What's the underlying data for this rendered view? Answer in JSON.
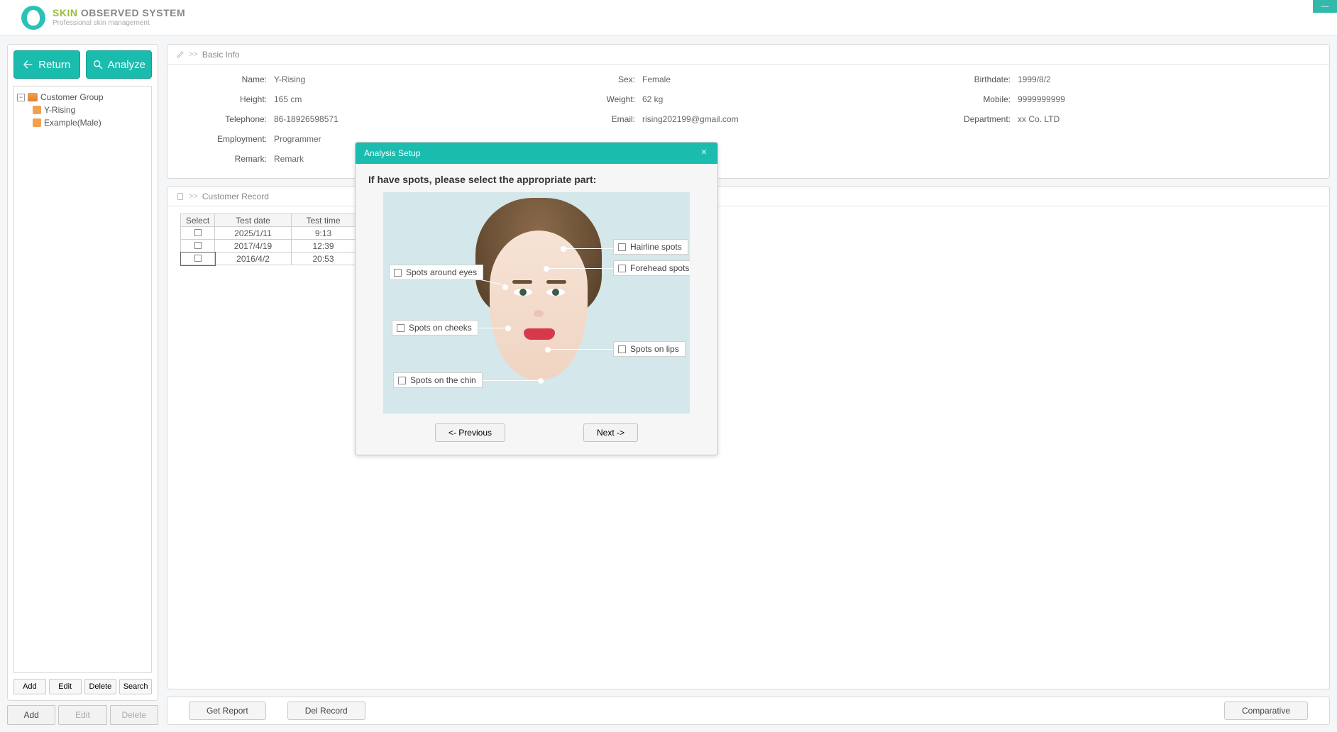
{
  "brand": {
    "skin": "SKIN",
    "obs": "OBSERVED SYSTEM",
    "sub": "Professional skin management"
  },
  "sidebar": {
    "return_label": "Return",
    "analyze_label": "Analyze",
    "tree": {
      "root": "Customer Group",
      "children": [
        "Y-Rising",
        "Example(Male)"
      ]
    },
    "toolbar1": {
      "add": "Add",
      "edit": "Edit",
      "delete": "Delete",
      "search": "Search"
    },
    "toolbar2": {
      "add": "Add",
      "edit": "Edit",
      "delete": "Delete"
    }
  },
  "basic": {
    "title": "Basic Info",
    "labels": {
      "name": "Name:",
      "sex": "Sex:",
      "birthdate": "Birthdate:",
      "height": "Height:",
      "weight": "Weight:",
      "mobile": "Mobile:",
      "telephone": "Telephone:",
      "email": "Email:",
      "department": "Department:",
      "employment": "Employment:",
      "remark": "Remark:"
    },
    "values": {
      "name": "Y-Rising",
      "sex": "Female",
      "birthdate": "1999/8/2",
      "height": "165 cm",
      "weight": "62 kg",
      "mobile": "9999999999",
      "telephone": "86-18926598571",
      "email": "rising202199@gmail.com",
      "department": "xx  Co. LTD",
      "employment": "Programmer",
      "remark": "Remark"
    }
  },
  "record": {
    "title": "Customer Record",
    "headers": {
      "select": "Select",
      "date": "Test date",
      "time": "Test time"
    },
    "rows": [
      {
        "date": "2025/1/11",
        "time": "9:13"
      },
      {
        "date": "2017/4/19",
        "time": "12:39"
      },
      {
        "date": "2016/4/2",
        "time": "20:53"
      }
    ]
  },
  "actions": {
    "get_report": "Get Report",
    "del_record": "Del Record",
    "comparative": "Comparative"
  },
  "modal": {
    "title": "Analysis Setup",
    "prompt": "If have spots, please select the appropriate part:",
    "spots": {
      "hairline": "Hairline spots",
      "forehead": "Forehead spots",
      "eyes": "Spots around eyes",
      "cheeks": "Spots on cheeks",
      "lips": "Spots on lips",
      "chin": "Spots on the chin"
    },
    "prev": "<-  Previous",
    "next": "Next  ->"
  }
}
